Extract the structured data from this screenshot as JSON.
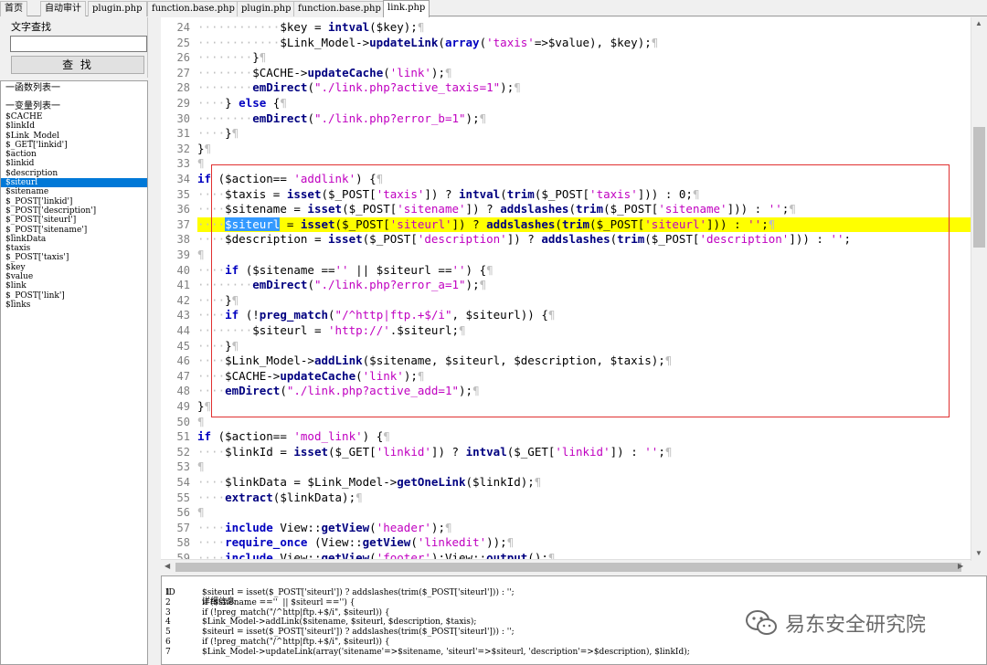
{
  "tabs": [
    "首页",
    "自动审计",
    "plugin.php",
    "function.base.php",
    "plugin.php",
    "function.base.php",
    "link.php"
  ],
  "active_tab_index": 6,
  "left_panel": {
    "search_label": "文字查找",
    "search_value": "",
    "find_button": "查 找",
    "functions_header": "一函数列表一",
    "variables_header": "一变量列表一",
    "variables": [
      "$CACHE",
      "$linkId",
      "$Link_Model",
      "$_GET['linkid']",
      "$action",
      "$linkid",
      "$description",
      "$siteurl",
      "$sitename",
      "$_POST['linkid']",
      "$_POST['description']",
      "$_POST['siteurl']",
      "$_POST['sitename']",
      "$linkData",
      "$taxis",
      "$_POST['taxis']",
      "$key",
      "$value",
      "$link",
      "$_POST['link']",
      "$links"
    ],
    "selected_variable_index": 7
  },
  "editor": {
    "highlighted_line": 37,
    "lines": [
      {
        "n": "24",
        "segs": [
          [
            "ws",
            "············"
          ],
          [
            "op",
            "$key = "
          ],
          [
            "fn",
            "intval"
          ],
          [
            "op",
            "($key);"
          ],
          [
            "ws",
            "¶"
          ]
        ]
      },
      {
        "n": "25",
        "segs": [
          [
            "ws",
            "············"
          ],
          [
            "op",
            "$Link_Model->"
          ],
          [
            "fn",
            "updateLink"
          ],
          [
            "op",
            "("
          ],
          [
            "kw",
            "array"
          ],
          [
            "op",
            "("
          ],
          [
            "str",
            "'taxis'"
          ],
          [
            "op",
            "=>$value), $key);"
          ],
          [
            "ws",
            "¶"
          ]
        ]
      },
      {
        "n": "26",
        "segs": [
          [
            "ws",
            "········"
          ],
          [
            "op",
            "}"
          ],
          [
            "ws",
            "¶"
          ]
        ]
      },
      {
        "n": "27",
        "segs": [
          [
            "ws",
            "········"
          ],
          [
            "op",
            "$CACHE->"
          ],
          [
            "fn",
            "updateCache"
          ],
          [
            "op",
            "("
          ],
          [
            "str",
            "'link'"
          ],
          [
            "op",
            ");"
          ],
          [
            "ws",
            "¶"
          ]
        ]
      },
      {
        "n": "28",
        "segs": [
          [
            "ws",
            "········"
          ],
          [
            "fn",
            "emDirect"
          ],
          [
            "op",
            "("
          ],
          [
            "str",
            "\"./link.php?active_taxis=1\""
          ],
          [
            "op",
            ");"
          ],
          [
            "ws",
            "¶"
          ]
        ]
      },
      {
        "n": "29",
        "segs": [
          [
            "ws",
            "····"
          ],
          [
            "op",
            "} "
          ],
          [
            "kw",
            "else"
          ],
          [
            "op",
            " {"
          ],
          [
            "ws",
            "¶"
          ]
        ]
      },
      {
        "n": "30",
        "segs": [
          [
            "ws",
            "········"
          ],
          [
            "fn",
            "emDirect"
          ],
          [
            "op",
            "("
          ],
          [
            "str",
            "\"./link.php?error_b=1\""
          ],
          [
            "op",
            ");"
          ],
          [
            "ws",
            "¶"
          ]
        ]
      },
      {
        "n": "31",
        "segs": [
          [
            "ws",
            "····"
          ],
          [
            "op",
            "}"
          ],
          [
            "ws",
            "¶"
          ]
        ]
      },
      {
        "n": "32",
        "segs": [
          [
            "op",
            "}"
          ],
          [
            "ws",
            "¶"
          ]
        ]
      },
      {
        "n": "33",
        "segs": [
          [
            "ws",
            "¶"
          ]
        ]
      },
      {
        "n": "34",
        "segs": [
          [
            "kw",
            "if"
          ],
          [
            "op",
            " ($action== "
          ],
          [
            "str",
            "'addlink'"
          ],
          [
            "op",
            ") {"
          ],
          [
            "ws",
            "¶"
          ]
        ]
      },
      {
        "n": "35",
        "segs": [
          [
            "ws",
            "····"
          ],
          [
            "op",
            "$taxis = "
          ],
          [
            "fn",
            "isset"
          ],
          [
            "op",
            "($_POST["
          ],
          [
            "str",
            "'taxis'"
          ],
          [
            "op",
            "]) ? "
          ],
          [
            "fn",
            "intval"
          ],
          [
            "op",
            "("
          ],
          [
            "fn",
            "trim"
          ],
          [
            "op",
            "($_POST["
          ],
          [
            "str",
            "'taxis'"
          ],
          [
            "op",
            "])) : 0;"
          ],
          [
            "ws",
            "¶"
          ]
        ]
      },
      {
        "n": "36",
        "segs": [
          [
            "ws",
            "····"
          ],
          [
            "op",
            "$sitename = "
          ],
          [
            "fn",
            "isset"
          ],
          [
            "op",
            "($_POST["
          ],
          [
            "str",
            "'sitename'"
          ],
          [
            "op",
            "]) ? "
          ],
          [
            "fn",
            "addslashes"
          ],
          [
            "op",
            "("
          ],
          [
            "fn",
            "trim"
          ],
          [
            "op",
            "($_POST["
          ],
          [
            "str",
            "'sitename'"
          ],
          [
            "op",
            "])) : "
          ],
          [
            "str",
            "''"
          ],
          [
            "op",
            ";"
          ],
          [
            "ws",
            "¶"
          ]
        ]
      },
      {
        "n": "37",
        "segs": [
          [
            "ws",
            "····"
          ],
          [
            "sel",
            "$siteurl"
          ],
          [
            "op",
            " = "
          ],
          [
            "fn",
            "isset"
          ],
          [
            "op",
            "($_POST["
          ],
          [
            "str",
            "'siteurl'"
          ],
          [
            "op",
            "]) ? "
          ],
          [
            "fn",
            "addslashes"
          ],
          [
            "op",
            "("
          ],
          [
            "fn",
            "trim"
          ],
          [
            "op",
            "($_POST["
          ],
          [
            "str",
            "'siteurl'"
          ],
          [
            "op",
            "])) : "
          ],
          [
            "str",
            "''"
          ],
          [
            "op",
            ";"
          ],
          [
            "ws",
            "¶"
          ]
        ]
      },
      {
        "n": "38",
        "segs": [
          [
            "ws",
            "····"
          ],
          [
            "op",
            "$description = "
          ],
          [
            "fn",
            "isset"
          ],
          [
            "op",
            "($_POST["
          ],
          [
            "str",
            "'description'"
          ],
          [
            "op",
            "]) ? "
          ],
          [
            "fn",
            "addslashes"
          ],
          [
            "op",
            "("
          ],
          [
            "fn",
            "trim"
          ],
          [
            "op",
            "($_POST["
          ],
          [
            "str",
            "'description'"
          ],
          [
            "op",
            "])) : "
          ],
          [
            "str",
            "''"
          ],
          [
            "op",
            ";"
          ]
        ]
      },
      {
        "n": "39",
        "segs": [
          [
            "ws",
            "¶"
          ]
        ]
      },
      {
        "n": "40",
        "segs": [
          [
            "ws",
            "····"
          ],
          [
            "kw",
            "if"
          ],
          [
            "op",
            " ($sitename =="
          ],
          [
            "str",
            "''"
          ],
          [
            "op",
            " || $siteurl =="
          ],
          [
            "str",
            "''"
          ],
          [
            "op",
            ") {"
          ],
          [
            "ws",
            "¶"
          ]
        ]
      },
      {
        "n": "41",
        "segs": [
          [
            "ws",
            "········"
          ],
          [
            "fn",
            "emDirect"
          ],
          [
            "op",
            "("
          ],
          [
            "str",
            "\"./link.php?error_a=1\""
          ],
          [
            "op",
            ");"
          ],
          [
            "ws",
            "¶"
          ]
        ]
      },
      {
        "n": "42",
        "segs": [
          [
            "ws",
            "····"
          ],
          [
            "op",
            "}"
          ],
          [
            "ws",
            "¶"
          ]
        ]
      },
      {
        "n": "43",
        "segs": [
          [
            "ws",
            "····"
          ],
          [
            "kw",
            "if"
          ],
          [
            "op",
            " (!"
          ],
          [
            "fn",
            "preg_match"
          ],
          [
            "op",
            "("
          ],
          [
            "str",
            "\"/^http|ftp.+$/i\""
          ],
          [
            "op",
            ", $siteurl)) {"
          ],
          [
            "ws",
            "¶"
          ]
        ]
      },
      {
        "n": "44",
        "segs": [
          [
            "ws",
            "········"
          ],
          [
            "op",
            "$siteurl = "
          ],
          [
            "str",
            "'http://'"
          ],
          [
            "op",
            ".$siteurl;"
          ],
          [
            "ws",
            "¶"
          ]
        ]
      },
      {
        "n": "45",
        "segs": [
          [
            "ws",
            "····"
          ],
          [
            "op",
            "}"
          ],
          [
            "ws",
            "¶"
          ]
        ]
      },
      {
        "n": "46",
        "segs": [
          [
            "ws",
            "····"
          ],
          [
            "op",
            "$Link_Model->"
          ],
          [
            "fn",
            "addLink"
          ],
          [
            "op",
            "($sitename, $siteurl, $description, $taxis);"
          ],
          [
            "ws",
            "¶"
          ]
        ]
      },
      {
        "n": "47",
        "segs": [
          [
            "ws",
            "····"
          ],
          [
            "op",
            "$CACHE->"
          ],
          [
            "fn",
            "updateCache"
          ],
          [
            "op",
            "("
          ],
          [
            "str",
            "'link'"
          ],
          [
            "op",
            ");"
          ],
          [
            "ws",
            "¶"
          ]
        ]
      },
      {
        "n": "48",
        "segs": [
          [
            "ws",
            "····"
          ],
          [
            "fn",
            "emDirect"
          ],
          [
            "op",
            "("
          ],
          [
            "str",
            "\"./link.php?active_add=1\""
          ],
          [
            "op",
            ");"
          ],
          [
            "ws",
            "¶"
          ]
        ]
      },
      {
        "n": "49",
        "segs": [
          [
            "op",
            "}"
          ],
          [
            "ws",
            "¶"
          ]
        ]
      },
      {
        "n": "50",
        "segs": [
          [
            "ws",
            "¶"
          ]
        ]
      },
      {
        "n": "51",
        "segs": [
          [
            "kw",
            "if"
          ],
          [
            "op",
            " ($action== "
          ],
          [
            "str",
            "'mod_link'"
          ],
          [
            "op",
            ") {"
          ],
          [
            "ws",
            "¶"
          ]
        ]
      },
      {
        "n": "52",
        "segs": [
          [
            "ws",
            "····"
          ],
          [
            "op",
            "$linkId = "
          ],
          [
            "fn",
            "isset"
          ],
          [
            "op",
            "($_GET["
          ],
          [
            "str",
            "'linkid'"
          ],
          [
            "op",
            "]) ? "
          ],
          [
            "fn",
            "intval"
          ],
          [
            "op",
            "($_GET["
          ],
          [
            "str",
            "'linkid'"
          ],
          [
            "op",
            "]) : "
          ],
          [
            "str",
            "''"
          ],
          [
            "op",
            ";"
          ],
          [
            "ws",
            "¶"
          ]
        ]
      },
      {
        "n": "53",
        "segs": [
          [
            "ws",
            "¶"
          ]
        ]
      },
      {
        "n": "54",
        "segs": [
          [
            "ws",
            "····"
          ],
          [
            "op",
            "$linkData = $Link_Model->"
          ],
          [
            "fn",
            "getOneLink"
          ],
          [
            "op",
            "($linkId);"
          ],
          [
            "ws",
            "¶"
          ]
        ]
      },
      {
        "n": "55",
        "segs": [
          [
            "ws",
            "····"
          ],
          [
            "fn",
            "extract"
          ],
          [
            "op",
            "($linkData);"
          ],
          [
            "ws",
            "¶"
          ]
        ]
      },
      {
        "n": "56",
        "segs": [
          [
            "ws",
            "¶"
          ]
        ]
      },
      {
        "n": "57",
        "segs": [
          [
            "ws",
            "····"
          ],
          [
            "kw",
            "include"
          ],
          [
            "op",
            " View::"
          ],
          [
            "fn",
            "getView"
          ],
          [
            "op",
            "("
          ],
          [
            "str",
            "'header'"
          ],
          [
            "op",
            ");"
          ],
          [
            "ws",
            "¶"
          ]
        ]
      },
      {
        "n": "58",
        "segs": [
          [
            "ws",
            "····"
          ],
          [
            "kw",
            "require_once"
          ],
          [
            "op",
            " (View::"
          ],
          [
            "fn",
            "getView"
          ],
          [
            "op",
            "("
          ],
          [
            "str",
            "'linkedit'"
          ],
          [
            "op",
            "));"
          ],
          [
            "ws",
            "¶"
          ]
        ]
      },
      {
        "n": "59",
        "segs": [
          [
            "ws",
            "····"
          ],
          [
            "kw",
            "include"
          ],
          [
            "op",
            " View::"
          ],
          [
            "fn",
            "getView"
          ],
          [
            "op",
            "("
          ],
          [
            "str",
            "'footer'"
          ],
          [
            "op",
            ");View::"
          ],
          [
            "fn",
            "output"
          ],
          [
            "op",
            "();"
          ],
          [
            "ws",
            "¶"
          ]
        ]
      }
    ]
  },
  "results": {
    "header_id": "ID",
    "header_detail": "详细信息",
    "rows": [
      {
        "id": "1",
        "detail": "$siteurl = isset($_POST['siteurl']) ? addslashes(trim($_POST['siteurl'])) : '';"
      },
      {
        "id": "2",
        "detail": "if ($sitename ==''  || $siteurl =='') {"
      },
      {
        "id": "3",
        "detail": "if (!preg_match(\"/^http|ftp.+$/i\", $siteurl)) {"
      },
      {
        "id": "4",
        "detail": "$Link_Model->addLink($sitename, $siteurl, $description, $taxis);"
      },
      {
        "id": "5",
        "detail": "$siteurl = isset($_POST['siteurl']) ? addslashes(trim($_POST['siteurl'])) : '';"
      },
      {
        "id": "6",
        "detail": "if (!preg_match(\"/^http|ftp.+$/i\", $siteurl)) {"
      },
      {
        "id": "7",
        "detail": "$Link_Model->updateLink(array('sitename'=>$sitename, 'siteurl'=>$siteurl, 'description'=>$description), $linkId);"
      }
    ]
  },
  "watermark": {
    "text": "易东安全研究院",
    "icon": "wechat-icon"
  },
  "colors": {
    "highlight_line": "#ffff00",
    "selection": "#3399ff",
    "selected_list_item": "#0078d7",
    "annotation_rect": "#e03030",
    "keyword": "#0000c0",
    "string": "#c000c0"
  }
}
